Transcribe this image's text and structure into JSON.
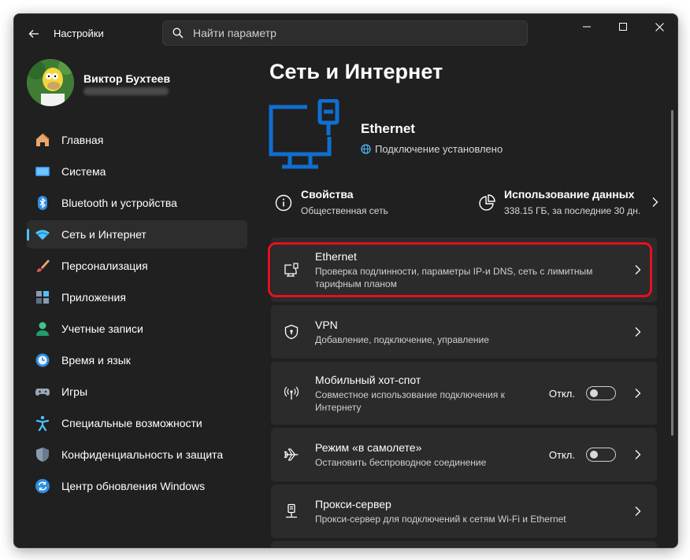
{
  "app": {
    "title": "Настройки"
  },
  "search": {
    "placeholder": "Найти параметр"
  },
  "user": {
    "name": "Виктор Бухтеев"
  },
  "sidebar": {
    "items": [
      {
        "label": "Главная",
        "icon": "home-icon"
      },
      {
        "label": "Система",
        "icon": "system-icon"
      },
      {
        "label": "Bluetooth и устройства",
        "icon": "bluetooth-icon"
      },
      {
        "label": "Сеть и Интернет",
        "icon": "network-icon",
        "active": true
      },
      {
        "label": "Персонализация",
        "icon": "brush-icon"
      },
      {
        "label": "Приложения",
        "icon": "apps-icon"
      },
      {
        "label": "Учетные записи",
        "icon": "accounts-icon"
      },
      {
        "label": "Время и язык",
        "icon": "time-language-icon"
      },
      {
        "label": "Игры",
        "icon": "gamepad-icon"
      },
      {
        "label": "Специальные возможности",
        "icon": "accessibility-icon"
      },
      {
        "label": "Конфиденциальность и защита",
        "icon": "shield-icon"
      },
      {
        "label": "Центр обновления Windows",
        "icon": "update-icon"
      }
    ]
  },
  "main": {
    "page_title": "Сеть и Интернет",
    "ethernet": {
      "title": "Ethernet",
      "status": "Подключение установлено"
    },
    "properties": {
      "title": "Свойства",
      "subtitle": "Общественная сеть"
    },
    "data_usage": {
      "title": "Использование данных",
      "subtitle": "338.15 ГБ, за последние 30 дн."
    },
    "cards": [
      {
        "title": "Ethernet",
        "subtitle": "Проверка подлинности, параметры IP-и DNS, сеть с лимитным тарифным планом",
        "icon": "ethernet-icon"
      },
      {
        "title": "VPN",
        "subtitle": "Добавление, подключение, управление",
        "icon": "vpn-shield-icon"
      },
      {
        "title": "Мобильный хот-спот",
        "subtitle": "Совместное использование подключения к Интернету",
        "toggle": "Откл.",
        "icon": "hotspot-icon"
      },
      {
        "title": "Режим «в самолете»",
        "subtitle": "Остановить беспроводное соединение",
        "toggle": "Откл.",
        "icon": "airplane-icon"
      },
      {
        "title": "Прокси-сервер",
        "subtitle": "Прокси-сервер для подключений к сетям Wi-Fi и Ethernet",
        "icon": "proxy-icon"
      }
    ]
  },
  "colors": {
    "accent": "#4cc2ff",
    "hero_blue": "#0f6fd1",
    "highlight": "#e8101e",
    "window_bg": "#202020",
    "card_bg": "#2b2b2b"
  }
}
